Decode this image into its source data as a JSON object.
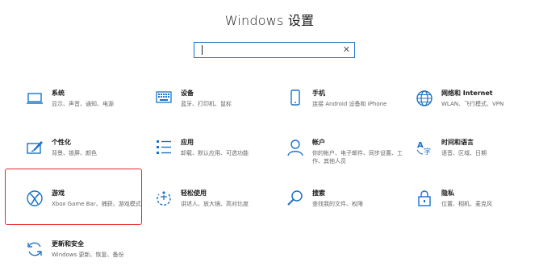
{
  "window": {
    "title": "Windows 设置"
  },
  "search": {
    "placeholder": "",
    "clear_glyph": "✕"
  },
  "accent": "#1a73c8",
  "highlight_color": "#e52a2a",
  "tiles": [
    {
      "title": "系统",
      "desc": "显示、声音、通知、电源",
      "icon": "laptop-icon"
    },
    {
      "title": "设备",
      "desc": "蓝牙、打印机、鼠标",
      "icon": "keyboard-icon"
    },
    {
      "title": "手机",
      "desc": "连接 Android 设备和 iPhone",
      "icon": "phone-icon"
    },
    {
      "title": "网络和 Internet",
      "desc": "WLAN、飞行模式、VPN",
      "icon": "globe-icon"
    },
    {
      "title": "个性化",
      "desc": "背景、锁屏、颜色",
      "icon": "paintbrush-icon"
    },
    {
      "title": "应用",
      "desc": "卸载、默认应用、可选功能",
      "icon": "apps-list-icon"
    },
    {
      "title": "帐户",
      "desc": "你的帐户、电子邮件、同步设置、工作、其他人员",
      "icon": "person-icon"
    },
    {
      "title": "时间和语言",
      "desc": "语音、区域、日期",
      "icon": "language-icon"
    },
    {
      "title": "游戏",
      "desc": "Xbox Game Bar、捕获、游戏模式",
      "icon": "xbox-icon"
    },
    {
      "title": "轻松使用",
      "desc": "讲述人、放大镜、高对比度",
      "icon": "ease-of-access-icon"
    },
    {
      "title": "搜索",
      "desc": "查找我的文件、权限",
      "icon": "search-icon"
    },
    {
      "title": "隐私",
      "desc": "位置、相机、麦克风",
      "icon": "lock-icon"
    },
    {
      "title": "更新和安全",
      "desc": "Windows 更新、恢复、备份",
      "icon": "update-icon"
    }
  ]
}
